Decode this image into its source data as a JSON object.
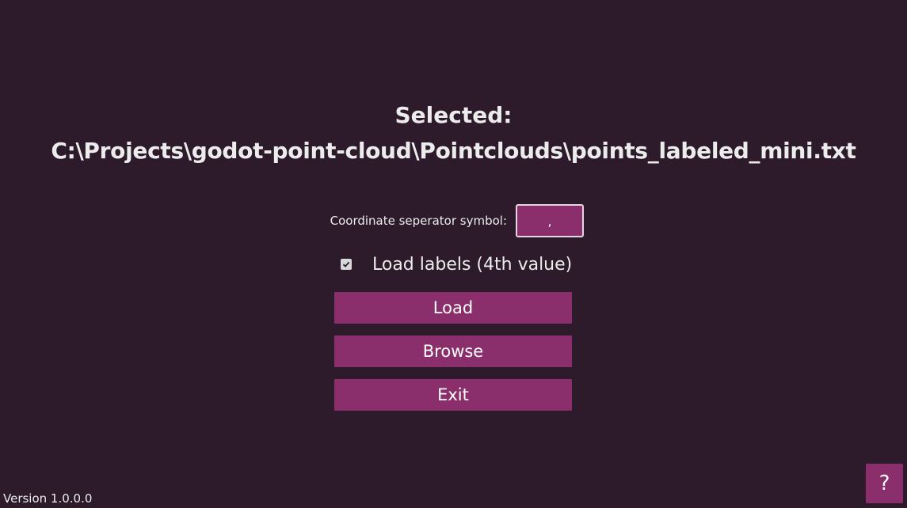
{
  "selection": {
    "label": "Selected:",
    "path": "C:\\Projects\\godot-point-cloud\\Pointclouds\\points_labeled_mini.txt"
  },
  "separator": {
    "label": "Coordinate seperator symbol:",
    "value": ","
  },
  "load_labels": {
    "label": "Load labels (4th value)",
    "checked": true
  },
  "buttons": {
    "load": "Load",
    "browse": "Browse",
    "exit": "Exit"
  },
  "help": {
    "label": "?"
  },
  "version": "Version 1.0.0.0",
  "colors": {
    "background": "#2d1b2c",
    "accent": "#8a2f6b",
    "text": "#ececec"
  }
}
